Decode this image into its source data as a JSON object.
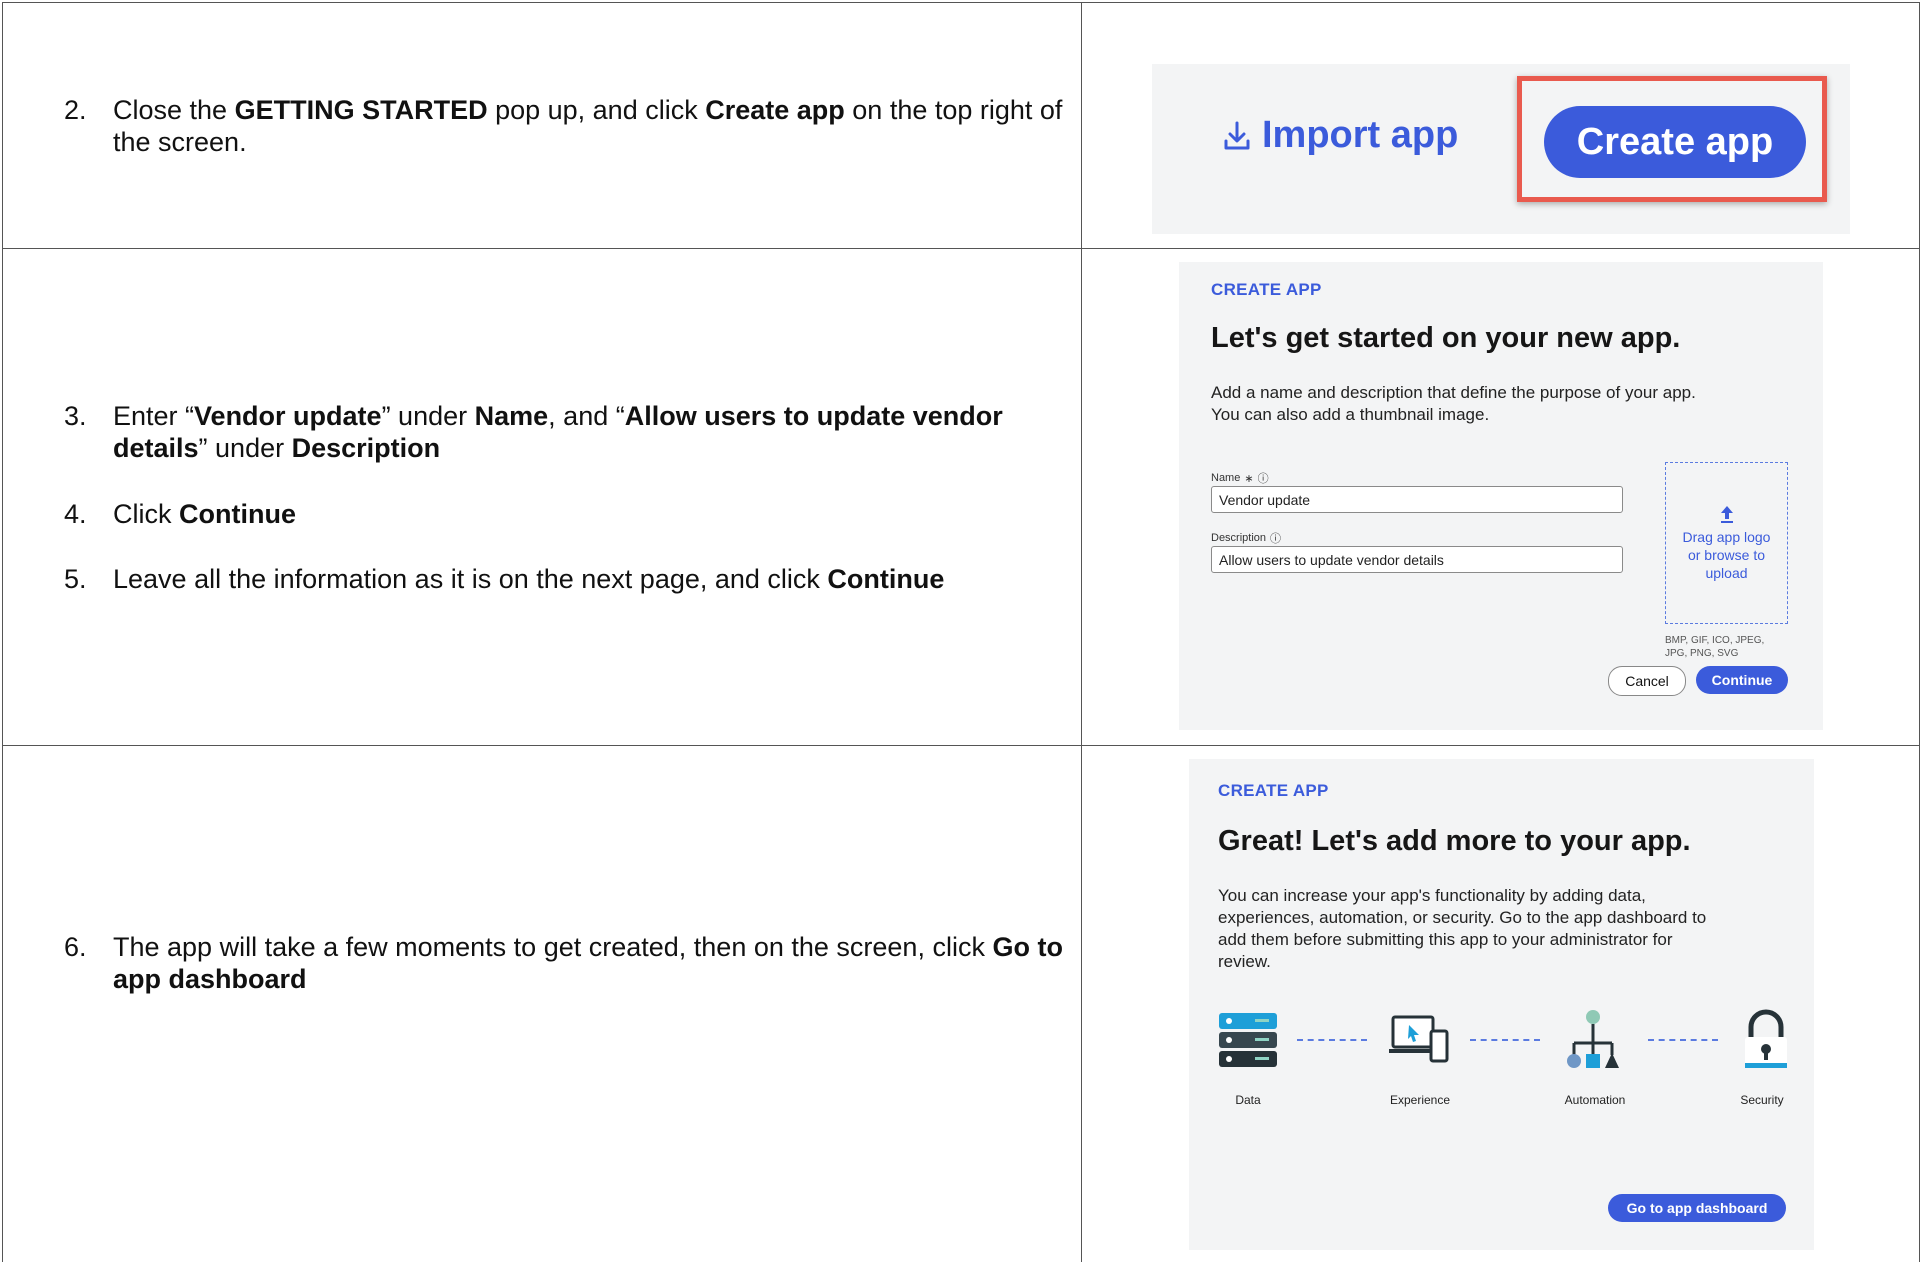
{
  "steps": {
    "s2": {
      "num": "2.",
      "t1": "Close the ",
      "b1": "GETTING STARTED",
      "t2": " pop up, and click ",
      "b2": "Create app",
      "t3": " on the top right of the screen."
    },
    "s3": {
      "num": "3.",
      "t1": "Enter “",
      "b1": "Vendor update",
      "t2": "” under ",
      "b2": "Name",
      "t3": ", and “",
      "b3": "Allow users to update vendor details",
      "t4": "” under ",
      "b4": "Description"
    },
    "s4": {
      "num": "4.",
      "t1": "Click ",
      "b1": "Continue"
    },
    "s5": {
      "num": "5.",
      "t1": "Leave all the information as it is on the next page, and click ",
      "b1": "Continue"
    },
    "s6": {
      "num": "6.",
      "t1": "The app will take a few moments to get created, then on the screen, click ",
      "b1": "Go to app dashboard"
    }
  },
  "panel1": {
    "import_label": "Import app",
    "create_label": "Create app",
    "highlight_color": "#e95a4e",
    "accent": "#3b5bdb"
  },
  "panel2": {
    "eyebrow": "CREATE APP",
    "title": "Let's get started on your new app.",
    "desc1": "Add a name and description that define the purpose of your app.",
    "desc2": "You can also add a thumbnail image.",
    "name_label": "Name",
    "name_value": "Vendor update",
    "desc_label": "Description",
    "desc_value": "Allow users to update vendor details",
    "upload_text1": "Drag app logo",
    "upload_text2": "or browse to",
    "upload_text3": "upload",
    "formats1": "BMP, GIF, ICO, JPEG,",
    "formats2": "JPG, PNG, SVG",
    "cancel_label": "Cancel",
    "continue_label": "Continue"
  },
  "panel3": {
    "eyebrow": "CREATE APP",
    "title": "Great! Let's add more to your app.",
    "desc": [
      "You can increase your app's functionality by adding data,",
      "experiences, automation, or security. Go to the app dashboard to",
      "add them before submitting this app to your administrator for",
      "review."
    ],
    "icons": [
      {
        "name": "database-icon",
        "label": "Data"
      },
      {
        "name": "devices-icon",
        "label": "Experience"
      },
      {
        "name": "flow-icon",
        "label": "Automation"
      },
      {
        "name": "lock-icon",
        "label": "Security"
      }
    ],
    "dashboard_label": "Go to app dashboard"
  }
}
